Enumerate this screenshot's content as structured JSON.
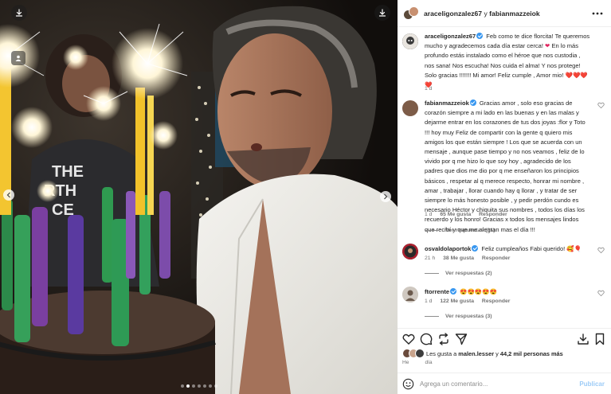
{
  "post": {
    "header_user1": "araceligonzalez67",
    "header_sep": "y",
    "header_user2": "fabianmazzeiok"
  },
  "comments": [
    {
      "username": "araceligonzalez67",
      "text": "Feb como te dice florcita! Te queremos mucho y agradecemos cada día estar cerca!",
      "text2": "En lo más profundo estás instalado como el héroe que nos custodia , nos sana! Nos escucha! Nos cuida el alma! Y nos protege! Solo gracias !!!!!!! Mi amor! Feliz cumple , Amor mio!",
      "hearts": "❤️❤️❤️❤️",
      "time": "1 d"
    },
    {
      "username": "fabianmazzeiok",
      "text": "Gracias amor , solo eso gracias de corazón siempre a mi lado en las buenas y en las malas y dejarme entrar en los corazones de tus dos joyas :flor y Toto !!! hoy muy Feliz de compartir con la gente q quiero mis amigos los que están siempre ! Los que se acuerda con un mensaje , aunque pase tiempo y no nos veamos , feliz de lo vivido por q me hizo lo que soy hoy , agradecido de los padres que dios me dio por q me enseñaron los principios básicos , respetar al q merece respecto, honrar mi nombre , amar , trabajar , llorar cuando hay q llorar , y tratar de ser siempre lo más honesto posible , y pedir perdón cundo es necesario Héctor y chiquita sus nombres , todos los días los recuerdo y los honro! Gracias x todos los mensajes lindos que recibí y que me alegran mas el día !!!",
      "time": "1 d",
      "likes": "65 Me gusta",
      "reply": "Responder",
      "replies": "Ver respuestas (31)"
    },
    {
      "username": "osvaldolaportok",
      "text": "Feliz cumpleaños Fabi querido! 🥰🎈",
      "time": "21 h",
      "likes": "38 Me gusta",
      "reply": "Responder",
      "replies": "Ver respuestas (2)"
    },
    {
      "username": "ftorrente",
      "text": "😍😍😍😍😍",
      "time": "1 d",
      "likes": "122 Me gusta",
      "reply": "Responder",
      "replies": "Ver respuestas (3)"
    }
  ],
  "footer": {
    "likes_prefix": "Les gusta a",
    "likes_user": "malen.lesser",
    "likes_mid": "y",
    "likes_count": "44,2 mil personas más",
    "date_left": "He",
    "date_right": "día",
    "comment_placeholder": "Agrega un comentario...",
    "publish_label": "Publicar"
  },
  "colors": {
    "accent": "#0095f6",
    "verified": "#3897f0",
    "heart": "#e0245e"
  },
  "icons": [
    "download-icon",
    "tag-icon",
    "more-icon",
    "heart-icon",
    "comment-icon",
    "share-icon",
    "save-icon",
    "emoji-icon"
  ]
}
